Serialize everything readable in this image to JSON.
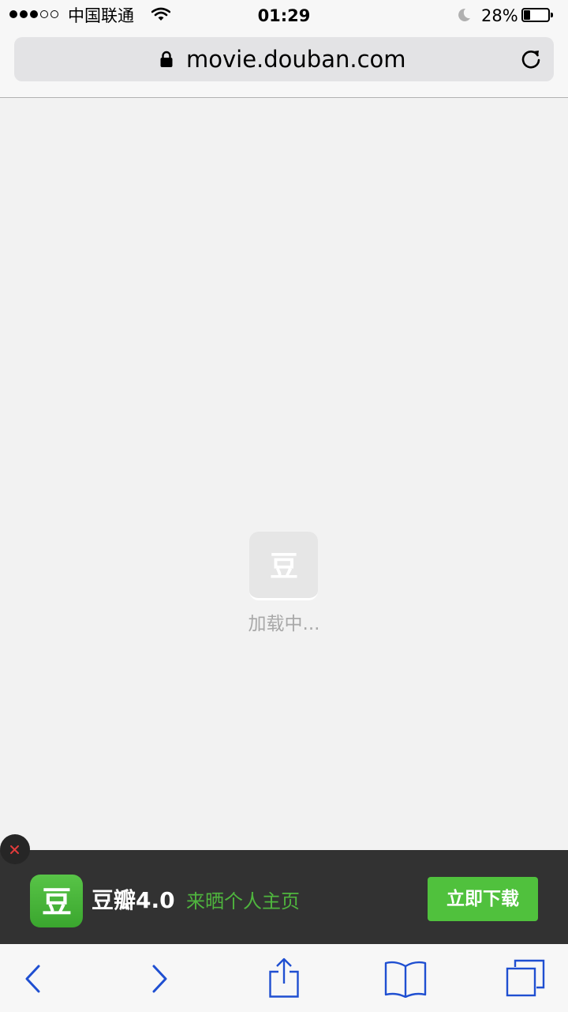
{
  "status_bar": {
    "carrier": "中国联通",
    "time": "01:29",
    "battery_percent": "28%",
    "battery_level": 0.28,
    "signal_bars_filled": 3,
    "signal_bars_total": 5,
    "icons": [
      "signal-dots",
      "wifi-icon",
      "moon-icon",
      "battery-icon"
    ]
  },
  "address_bar": {
    "url": "movie.douban.com",
    "icons": [
      "lock-icon",
      "reload-icon"
    ]
  },
  "loading": {
    "logo_glyph": "豆",
    "text": "加载中..."
  },
  "app_banner": {
    "icon_glyph": "豆",
    "app_name": "豆瓣4.0",
    "slogan": "来晒个人主页",
    "download_label": "立即下载",
    "icons": [
      "close-icon",
      "douban-app-icon"
    ]
  },
  "toolbar": {
    "icons": [
      "back-icon",
      "forward-icon",
      "share-icon",
      "bookmarks-icon",
      "tabs-icon"
    ]
  },
  "colors": {
    "page_background": "#f2f2f2",
    "banner_background": "#323232",
    "brand_green": "#50c13d",
    "slogan_green": "#4fb53e",
    "toolbar_icon_blue": "#1f4fd1",
    "close_x_red": "#e23b3b"
  }
}
